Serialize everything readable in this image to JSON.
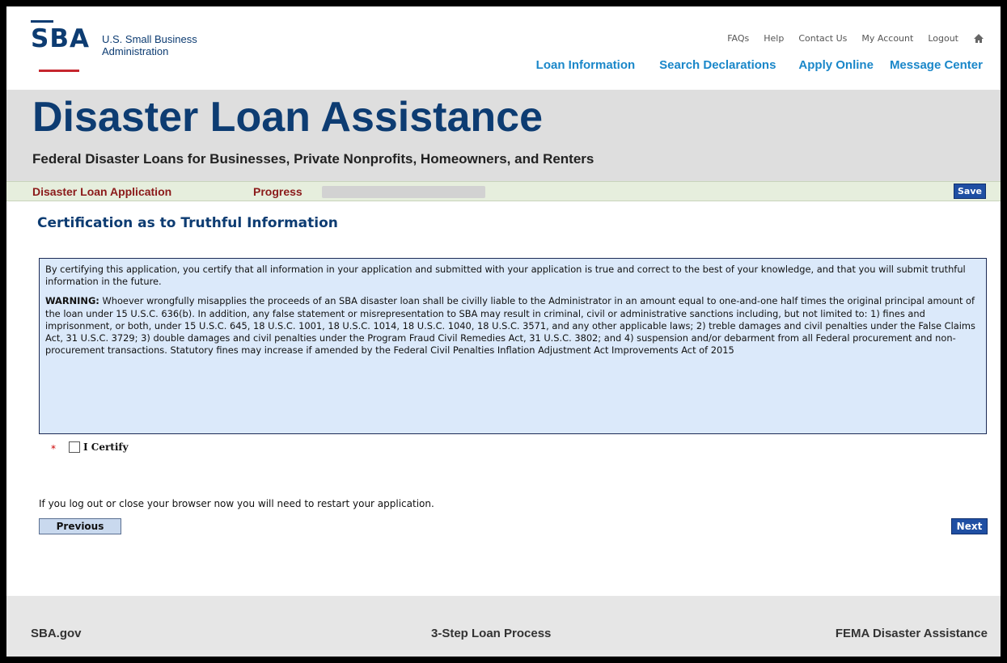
{
  "header": {
    "logo_text": "SBA",
    "agency_line1": "U.S. Small Business",
    "agency_line2": "Administration",
    "utility_links": [
      "FAQs",
      "Help",
      "Contact Us",
      "My Account",
      "Logout"
    ],
    "home_icon": "home-icon",
    "main_nav": [
      "Loan Information",
      "Search Declarations",
      "Apply Online",
      "Message Center"
    ]
  },
  "banner": {
    "title": "Disaster Loan Assistance",
    "subtitle": "Federal Disaster Loans for Businesses, Private Nonprofits, Homeowners, and Renters"
  },
  "progress": {
    "app_label": "Disaster Loan Application",
    "label": "Progress",
    "fraction": 0.0,
    "save_label": "Save"
  },
  "main": {
    "section_title": "Certification as to Truthful Information",
    "paragraph1": "By certifying this application, you certify that all information in your application and submitted with your application is true and correct to the best of your knowledge, and that you will submit truthful information in the future.",
    "warning_label": "WARNING:",
    "warning_text": " Whoever wrongfully misapplies the proceeds of an SBA disaster loan shall be civilly liable to the Administrator in an amount equal to one-and-one half times the original principal amount of the loan under 15 U.S.C. 636(b). In addition, any false statement or misrepresentation to SBA may result in criminal, civil or administrative sanctions including, but not limited to: 1) fines and imprisonment, or both, under 15 U.S.C. 645, 18 U.S.C. 1001, 18 U.S.C. 1014, 18 U.S.C. 1040, 18 U.S.C. 3571, and any other applicable laws; 2) treble damages and civil penalties under the False Claims Act, 31 U.S.C. 3729; 3) double damages and civil penalties under the Program Fraud Civil Remedies Act, 31 U.S.C. 3802; and 4) suspension and/or debarment from all Federal procurement and non-procurement transactions. Statutory fines may increase if amended by the Federal Civil Penalties Inflation Adjustment Act Improvements Act of 2015",
    "required_marker": "*",
    "certify_label": "I Certify",
    "certify_checked": false,
    "logout_note": "If you log out or close your browser now you will need to restart your application.",
    "previous_label": "Previous",
    "next_label": "Next"
  },
  "footer": {
    "links": [
      "SBA.gov",
      "3-Step Loan Process",
      "FEMA Disaster Assistance"
    ]
  },
  "colors": {
    "brand_blue": "#0d3c72",
    "nav_blue": "#1a87c9",
    "progress_red": "#8b1a1a",
    "box_bg": "#dbe9fa"
  }
}
